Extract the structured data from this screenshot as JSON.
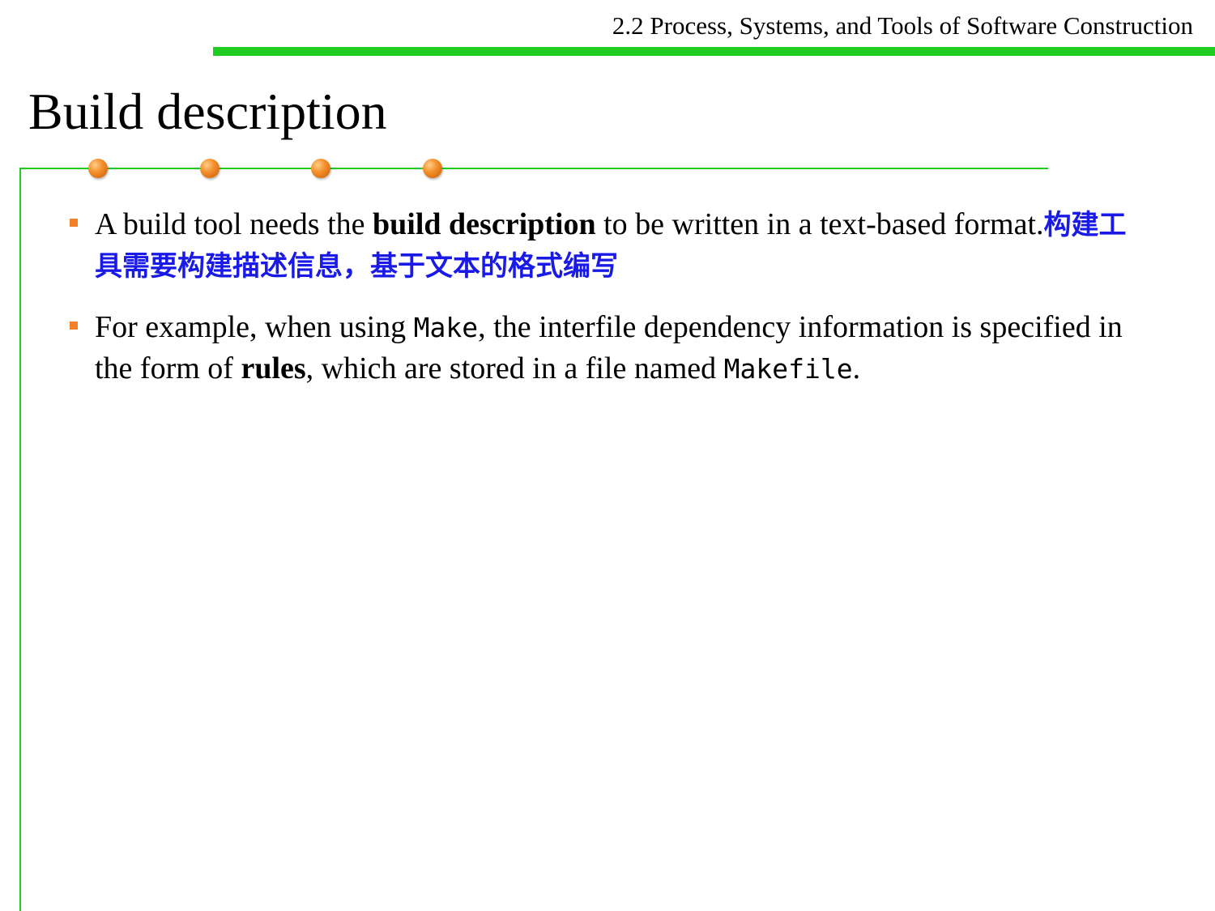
{
  "header": {
    "section_title": "2.2 Process, Systems, and Tools of Software Construction"
  },
  "slide": {
    "title": "Build description"
  },
  "colors": {
    "accent_green": "#1fcc1f",
    "bullet_orange": "#f4802a",
    "chinese_blue": "#1a1ae6"
  },
  "bullets": [
    {
      "text_before": "A build tool needs the ",
      "bold": "build description",
      "text_after": " to be written in a text-based format.",
      "chinese": "构建工具需要构建描述信息，基于文本的格式编写"
    },
    {
      "text_1": "For example, when using ",
      "code_1": "Make",
      "text_2": ", the interfile dependency information is specified in the form of ",
      "bold": "rules",
      "text_3": ", which are stored in a file named ",
      "code_2": "Makefile",
      "text_4": "."
    }
  ]
}
